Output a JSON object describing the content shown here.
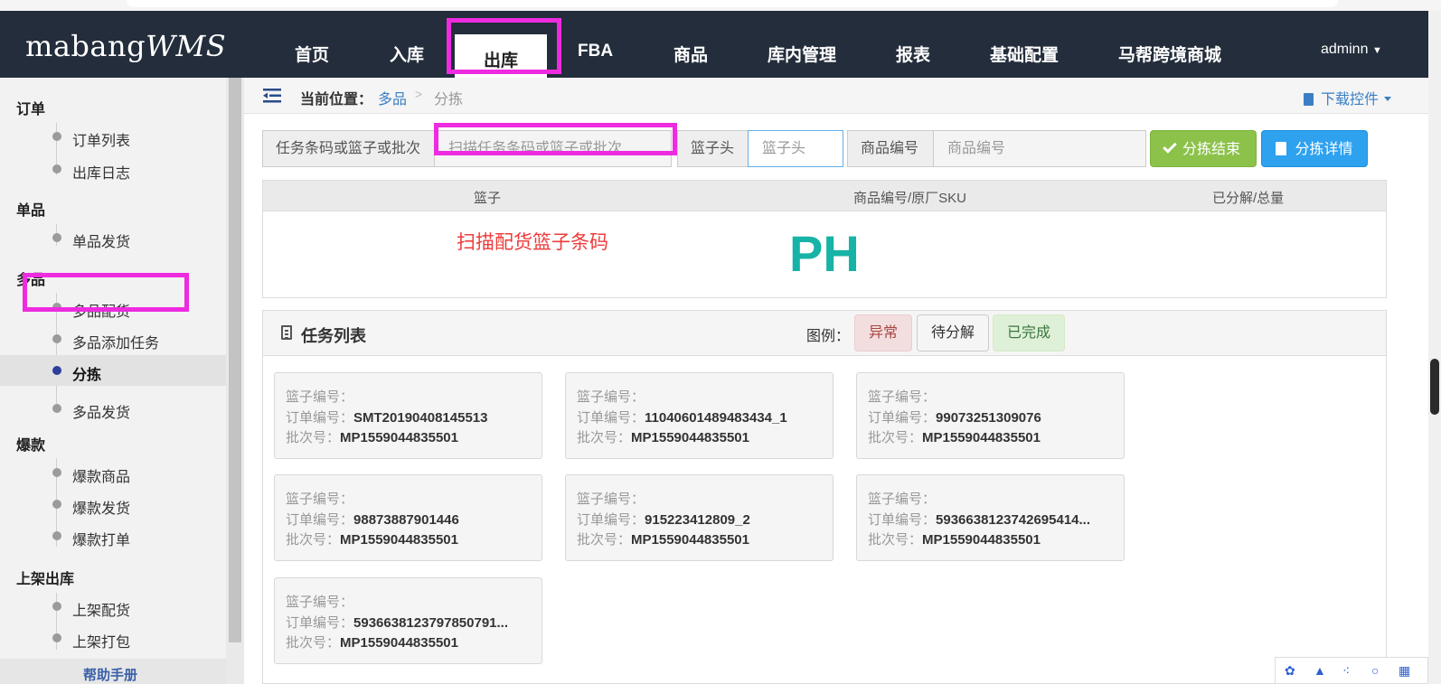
{
  "logo": {
    "main": "mabang",
    "suffix": "WMS"
  },
  "nav": {
    "items": [
      "首页",
      "入库",
      "出库",
      "FBA",
      "商品",
      "库内管理",
      "报表",
      "基础配置",
      "马帮跨境商城"
    ],
    "active": "出库",
    "user": "adminn"
  },
  "sidebar": {
    "groups": [
      {
        "title": "订单",
        "items": [
          "订单列表",
          "出库日志"
        ]
      },
      {
        "title": "单品",
        "items": [
          "单品发货"
        ]
      },
      {
        "title": "多品",
        "items": [
          "多品配货",
          "多品添加任务",
          "分拣",
          "多品发货"
        ]
      },
      {
        "title": "爆款",
        "items": [
          "爆款商品",
          "爆款发货",
          "爆款打单"
        ]
      },
      {
        "title": "上架出库",
        "items": [
          "上架配货",
          "上架打包"
        ]
      }
    ],
    "active_item": "分拣",
    "help": "帮助手册"
  },
  "breadcrumb": {
    "label": "当前位置：",
    "link": "多品",
    "separator": ">",
    "current": "分拣",
    "download": "下载控件"
  },
  "scan_bar": {
    "task_label": "任务条码或篮子或批次",
    "task_placeholder": "扫描任务条码或篮子或批次",
    "basket_label": "篮子头",
    "basket_placeholder": "篮子头",
    "sku_label": "商品编号",
    "sku_placeholder": "商品编号",
    "finish_button": "分拣结束",
    "detail_button": "分拣详情"
  },
  "scan_table": {
    "headers": [
      "篮子",
      "商品编号/原厂SKU",
      "已分解/总量"
    ],
    "prompt": "扫描配货篮子条码",
    "big_text": "PH"
  },
  "task_panel": {
    "title": "任务列表",
    "legend_label": "图例：",
    "legend": [
      {
        "label": "异常",
        "bg": "#f2dede",
        "color": "#a94442"
      },
      {
        "label": "待分解",
        "bg": "#f5f5f5",
        "color": "#333333"
      },
      {
        "label": "已完成",
        "bg": "#dff0d8",
        "color": "#3c763d"
      }
    ],
    "field_labels": {
      "basket": "篮子编号：",
      "order": "订单编号：",
      "batch": "批次号："
    },
    "tasks": [
      {
        "basket": "",
        "order": "SMT20190408145513",
        "batch": "MP1559044835501"
      },
      {
        "basket": "",
        "order": "11040601489483434_1",
        "batch": "MP1559044835501"
      },
      {
        "basket": "",
        "order": "99073251309076",
        "batch": "MP1559044835501"
      },
      {
        "basket": "",
        "order": "98873887901446",
        "batch": "MP1559044835501"
      },
      {
        "basket": "",
        "order": "915223412809_2",
        "batch": "MP1559044835501"
      },
      {
        "basket": "",
        "order": "5936638123742695414...",
        "batch": "MP1559044835501"
      },
      {
        "basket": "",
        "order": "5936638123797850791...",
        "batch": "MP1559044835501"
      }
    ]
  },
  "colors": {
    "navbar": "#232d3b",
    "highlight": "#ee2bdf",
    "accent_green": "#8cc24a",
    "accent_blue": "#2ea1ef",
    "ph_teal": "#17b3a6",
    "prompt_red": "#ee3b3b"
  },
  "icons": [
    "menu-toggle-icon",
    "download-doc-icon",
    "check-icon",
    "clipboard-icon",
    "list-icon",
    "caret-down-icon"
  ]
}
